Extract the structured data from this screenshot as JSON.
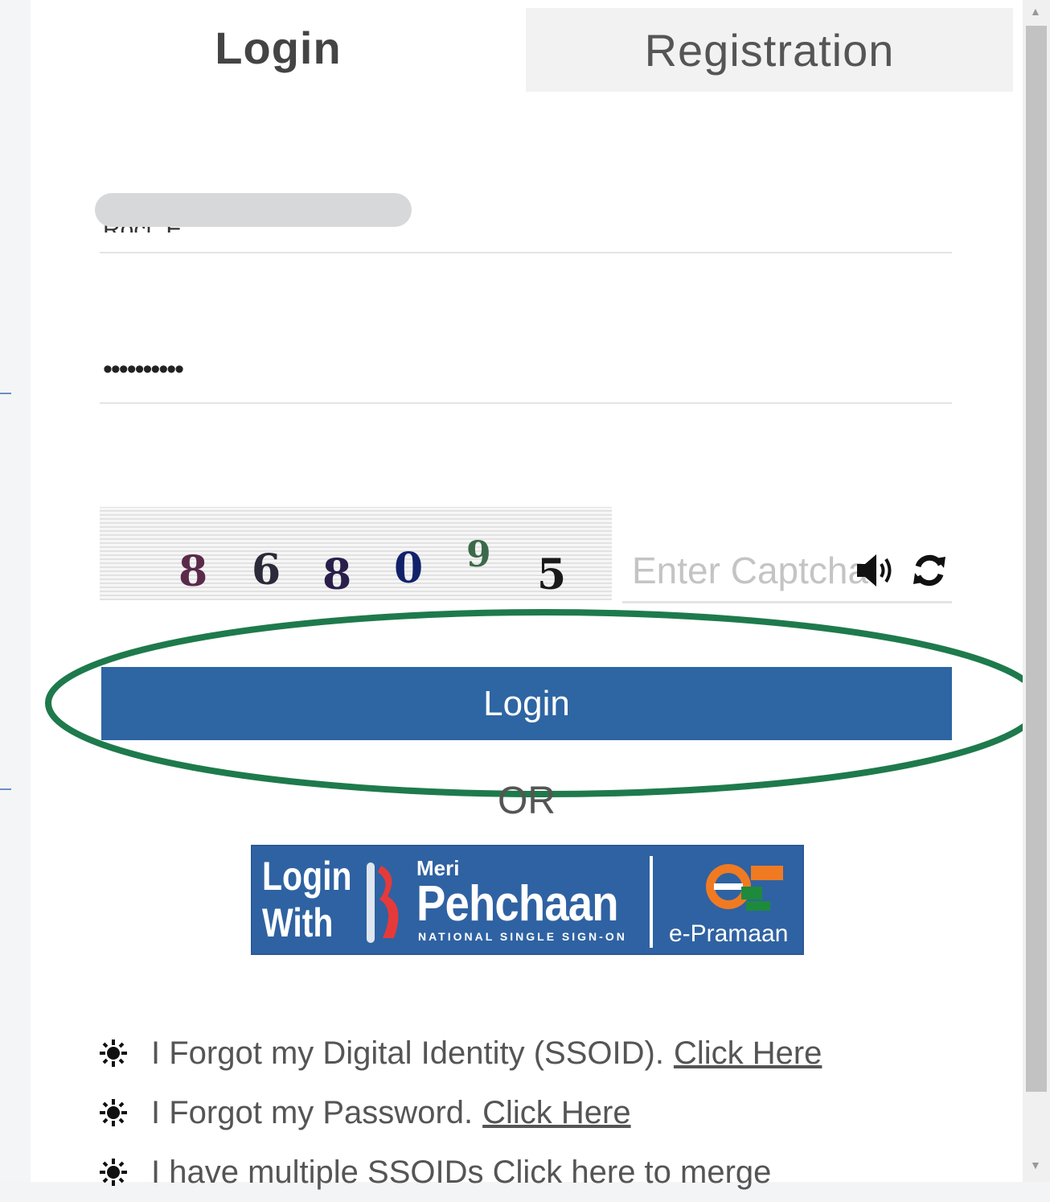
{
  "tabs": {
    "login": "Login",
    "registration": "Registration"
  },
  "form": {
    "username_value": "Roct. E",
    "password_masked": "••••••••••",
    "captcha_digits": [
      {
        "char": "8",
        "color": "#5a2a4a"
      },
      {
        "char": "6",
        "color": "#2a2a3a"
      },
      {
        "char": "8",
        "color": "#2a1f4a"
      },
      {
        "char": "0",
        "color": "#12226a"
      },
      {
        "char": "9",
        "color": "#3a6a4a"
      },
      {
        "char": "5",
        "color": "#1a1a1a"
      }
    ],
    "captcha_placeholder": "Enter Captcha",
    "login_button": "Login"
  },
  "or_text": "OR",
  "sso": {
    "login_with_line1": "Login",
    "login_with_line2": "With",
    "meri": "Meri",
    "pehchaan": "Pehchaan",
    "tagline": "NATIONAL SINGLE SIGN-ON",
    "epramaan": "e-Pramaan"
  },
  "links": [
    {
      "text": "I Forgot my Digital Identity (SSOID).",
      "link": "Click Here"
    },
    {
      "text": "I Forgot my Password.",
      "link": "Click Here"
    },
    {
      "text": "I have multiple SSOIDs Click here to merge",
      "link": ""
    }
  ],
  "colors": {
    "primary": "#2e65a3",
    "highlight_ellipse": "#1e7a4c"
  }
}
